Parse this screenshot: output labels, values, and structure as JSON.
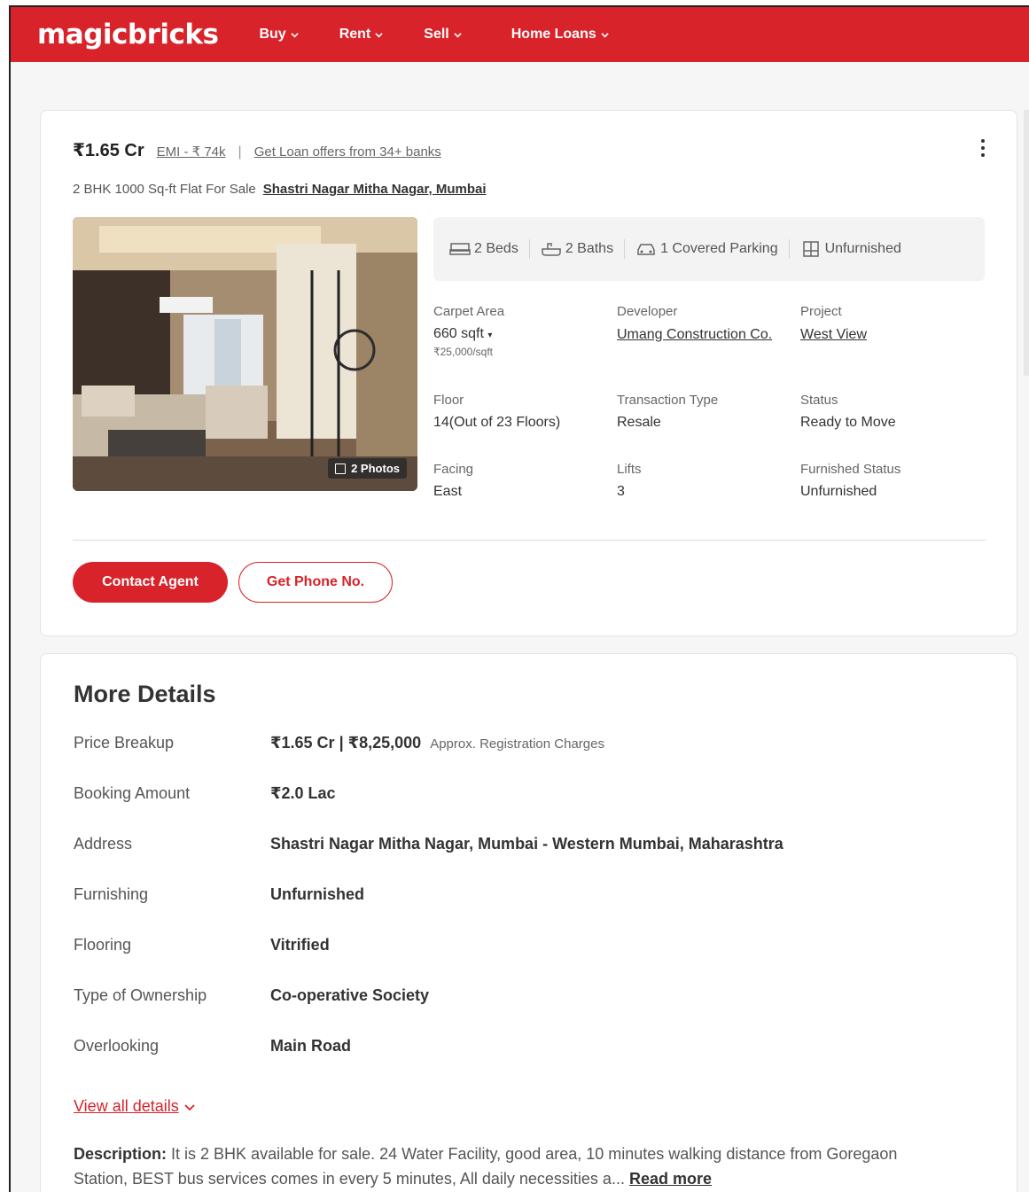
{
  "header": {
    "logo": "magicbricks",
    "nav": [
      {
        "label": "Buy"
      },
      {
        "label": "Rent"
      },
      {
        "label": "Sell"
      },
      {
        "label": "Home Loans"
      }
    ]
  },
  "listing": {
    "price": "₹1.65 Cr",
    "emi": "EMI - ₹ 74k",
    "loan_offer": "Get Loan offers from 34+ banks",
    "title": "2 BHK 1000 Sq-ft Flat For Sale",
    "location": "Shastri Nagar Mitha Nagar, Mumbai",
    "photo_count": "2 Photos",
    "amenities": {
      "beds": "2 Beds",
      "baths": "2 Baths",
      "parking": "1 Covered Parking",
      "furnishing": "Unfurnished"
    },
    "specs": {
      "carpet_label": "Carpet Area",
      "carpet_value": "660 sqft",
      "carpet_rate": "₹25,000/sqft",
      "developer_label": "Developer",
      "developer_value": "Umang Construction Co.",
      "project_label": "Project",
      "project_value": "West View",
      "floor_label": "Floor",
      "floor_value": "14(Out of 23 Floors)",
      "transaction_label": "Transaction Type",
      "transaction_value": "Resale",
      "status_label": "Status",
      "status_value": "Ready to Move",
      "facing_label": "Facing",
      "facing_value": "East",
      "lifts_label": "Lifts",
      "lifts_value": "3",
      "furnished_label": "Furnished Status",
      "furnished_value": "Unfurnished"
    },
    "buttons": {
      "contact": "Contact Agent",
      "phone": "Get Phone No."
    }
  },
  "more_details": {
    "title": "More Details",
    "rows": [
      {
        "label": "Price Breakup",
        "value": "₹1.65 Cr | ₹8,25,000",
        "extra": "Approx. Registration Charges"
      },
      {
        "label": "Booking Amount",
        "value": "₹2.0 Lac"
      },
      {
        "label": "Address",
        "value": "Shastri Nagar Mitha Nagar, Mumbai - Western Mumbai, Maharashtra"
      },
      {
        "label": "Furnishing",
        "value": "Unfurnished"
      },
      {
        "label": "Flooring",
        "value": "Vitrified"
      },
      {
        "label": "Type of Ownership",
        "value": "Co-operative Society"
      },
      {
        "label": "Overlooking",
        "value": "Main Road"
      }
    ],
    "view_all": "View all details",
    "description_label": "Description:",
    "description_text": "It is 2 BHK available for sale. 24 Water Facility, good area, 10 minutes walking distance from Goregaon Station, BEST bus services comes in every 5 minutes, All daily necessities a...",
    "read_more": "Read more"
  },
  "colors": {
    "brand": "#d8232a"
  }
}
